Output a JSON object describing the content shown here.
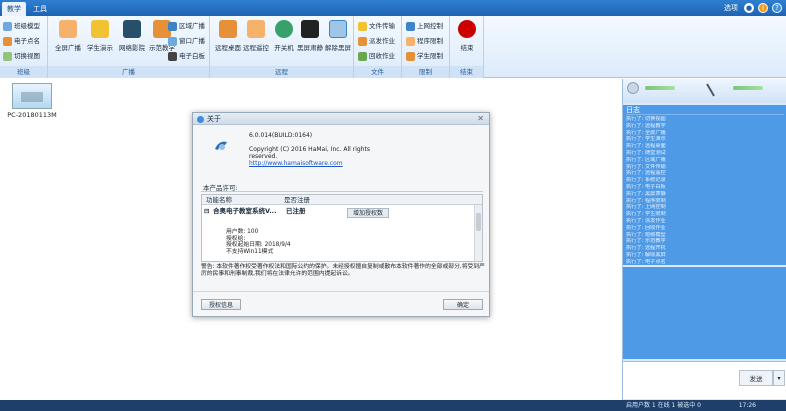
{
  "topbar": {
    "tabs": [
      "教学",
      "工具"
    ],
    "options_label": "选项",
    "help_glyph": "?"
  },
  "ribbon": {
    "groups": {
      "class": {
        "label": "班级",
        "items": [
          "班级模型",
          "电子点名",
          "切换视图"
        ]
      },
      "broadcast": {
        "label": "广播",
        "big": [
          "全屏广播",
          "学生演示",
          "网络影院",
          "示范教学"
        ],
        "small": [
          "区域广播",
          "窗口广播",
          "电子白板"
        ]
      },
      "remote": {
        "label": "远程",
        "big": [
          "远程桌面",
          "远程遥控",
          "开关机",
          "黑屏肃静",
          "解除黑屏"
        ]
      },
      "file": {
        "label": "文件",
        "items": [
          "文件传输",
          "派发作业",
          "回收作业"
        ]
      },
      "limit": {
        "label": "限制",
        "items": [
          "上网控制",
          "程序限制",
          "学生限制"
        ]
      },
      "end": {
        "label": "结束",
        "big": "结束"
      }
    }
  },
  "main": {
    "computer_name": "PC-20180113M"
  },
  "about": {
    "title": "关于",
    "version": "6.0.014(BUILD:0164)",
    "copyright": "Copyright (C) 2016 HaMai, Inc. All rights reserved.",
    "website": "http://www.hamaisoftware.com",
    "license_label": "本产品许可:",
    "columns": [
      "功能名称",
      "是否注册"
    ],
    "row": {
      "expander": "⊟",
      "name": "合奥电子教室系统V...",
      "status": "已注册"
    },
    "add_license_button": "增加授权数",
    "details": [
      "用户数: 100",
      "授权给:",
      "授权起始日期: 2018/9/4",
      "不支持Win11模式"
    ],
    "warning": "警告: 本软件著作权受著作权法和国际公约的保护。未经授权擅自复制或散布本软件著作的全部或部分,将受到严厉的民事和刑事制裁,我们将在法律允许的范围内提起诉讼。",
    "license_info_button": "授权信息",
    "ok_button": "确定"
  },
  "log": {
    "title": "日志",
    "lines": [
      "执行了: 切换视图",
      "执行了: 远程教学",
      "执行了: 全屏广播",
      "执行了: 学生演示",
      "执行了: 远程桌面",
      "执行了: 随堂测试",
      "执行了: 区域广播",
      "执行了: 文件传输",
      "执行了: 远程遥控",
      "执行了: 系统记录",
      "执行了: 电子白板",
      "执行了: 黑屏肃静",
      "执行了: 程序限制",
      "执行了: 上网控制",
      "执行了: 学生限制",
      "执行了: 派发作业",
      "执行了: 回收作业",
      "执行了: 班级模型",
      "执行了: 示范教学",
      "执行了: 远程开机",
      "执行了: 解除黑屏",
      "执行了: 电子点名",
      "执行了: 结束"
    ]
  },
  "chat": {
    "send_label": "发送",
    "arrow": "▾"
  },
  "status": {
    "left": "启用户数 1 在线 1 被选中 0",
    "time": "17:26"
  },
  "colors": {
    "accent": "#1e63b3",
    "log_bg": "#4f9ae6",
    "status_bg": "#1f3f6b"
  }
}
